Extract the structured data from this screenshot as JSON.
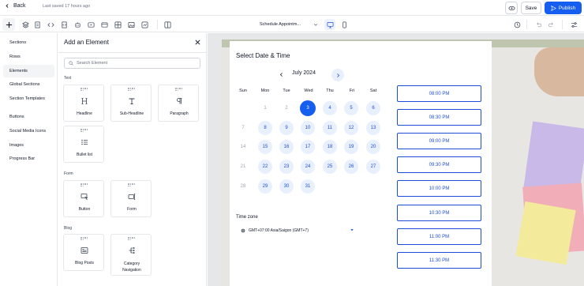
{
  "header": {
    "back_label": "Back",
    "saved_status": "Last saved 17 hours ago",
    "save_label": "Save",
    "publish_label": "Publish"
  },
  "toolbar": {
    "page_select": "Schedule Appointm..."
  },
  "leftnav": {
    "items": [
      "Sections",
      "Rows",
      "Elements",
      "Global Sections",
      "Section Templates",
      "Buttons",
      "Social Media Icons",
      "Images",
      "Progress Bar"
    ],
    "active": "Elements"
  },
  "panel": {
    "title": "Add an Element",
    "search_placeholder": "Search Element",
    "groups": {
      "text": "Text",
      "form": "Form",
      "blog": "Blog"
    },
    "tiles": {
      "headline": "Headline",
      "subheadline": "Sub-Headline",
      "paragraph": "Paragraph",
      "bullet_list": "Bullet list",
      "button": "Button",
      "form": "Form",
      "blog_posts": "Blog Posts",
      "category_nav_1": "Category",
      "category_nav_2": "Navigation"
    }
  },
  "calendar": {
    "title": "Select Date & Time",
    "month": "July 2024",
    "weekdays": [
      "Sun",
      "Mon",
      "Tue",
      "Wed",
      "Thu",
      "Fri",
      "Sat"
    ],
    "weeks": [
      [
        "",
        "1",
        "2",
        "3",
        "4",
        "5",
        "6"
      ],
      [
        "7",
        "8",
        "9",
        "10",
        "11",
        "12",
        "13"
      ],
      [
        "14",
        "15",
        "16",
        "17",
        "18",
        "19",
        "20"
      ],
      [
        "21",
        "22",
        "23",
        "24",
        "25",
        "26",
        "27"
      ],
      [
        "28",
        "29",
        "30",
        "31",
        "",
        "",
        ""
      ]
    ],
    "selected_day": "3",
    "timezone_label": "Time zone",
    "timezone_value": "GMT+07:00 Asia/Saigon (GMT+7)"
  },
  "time_slots": [
    "08:00 PM",
    "08:30 PM",
    "09:00 PM",
    "09:30 PM",
    "10:00 PM",
    "10:30 PM",
    "11:00 PM",
    "11:30 PM"
  ],
  "colors": {
    "accent": "#155eef",
    "available_day_bg": "#e8f0fe",
    "slot_border": "#1d4ed8"
  }
}
